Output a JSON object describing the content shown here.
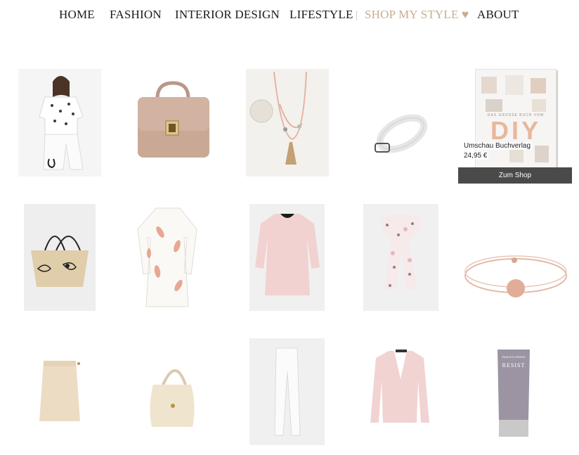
{
  "nav": {
    "items": [
      {
        "label": "HOME"
      },
      {
        "label": "FASHION"
      },
      {
        "label": "INTERIOR DESIGN"
      },
      {
        "label": "LIFESTYLE"
      },
      {
        "label": "SHOP MY STYLE ♥",
        "active": true
      },
      {
        "label": "ABOUT"
      }
    ],
    "active_color": "#c8ad8e"
  },
  "products": [
    {
      "icon": "white-blouse-with-print"
    },
    {
      "icon": "nude-leather-handbag"
    },
    {
      "icon": "tassel-necklace"
    },
    {
      "icon": "white-belt"
    },
    {
      "icon": "straw-basket-bag"
    },
    {
      "icon": "floral-white-shirt-dress"
    },
    {
      "icon": "pink-coat"
    },
    {
      "icon": "floral-scarf"
    },
    {
      "icon": "rose-gold-bracelet"
    },
    {
      "icon": "beige-pencil-skirt"
    },
    {
      "icon": "cream-hobo-bag"
    },
    {
      "icon": "white-trousers"
    },
    {
      "icon": "pink-blazer"
    },
    {
      "icon": "body-lotion-tube"
    }
  ],
  "book": {
    "cover_title": "DIY",
    "cover_subtitle": "DAS GROSSE BUCH VOM",
    "publisher": "Umschau Buchverlag",
    "price": "24,95 €",
    "button_label": "Zum Shop"
  },
  "product_text": {
    "lotion_brand": "PAULA'S CHOICE",
    "lotion_name": "RESIST"
  }
}
